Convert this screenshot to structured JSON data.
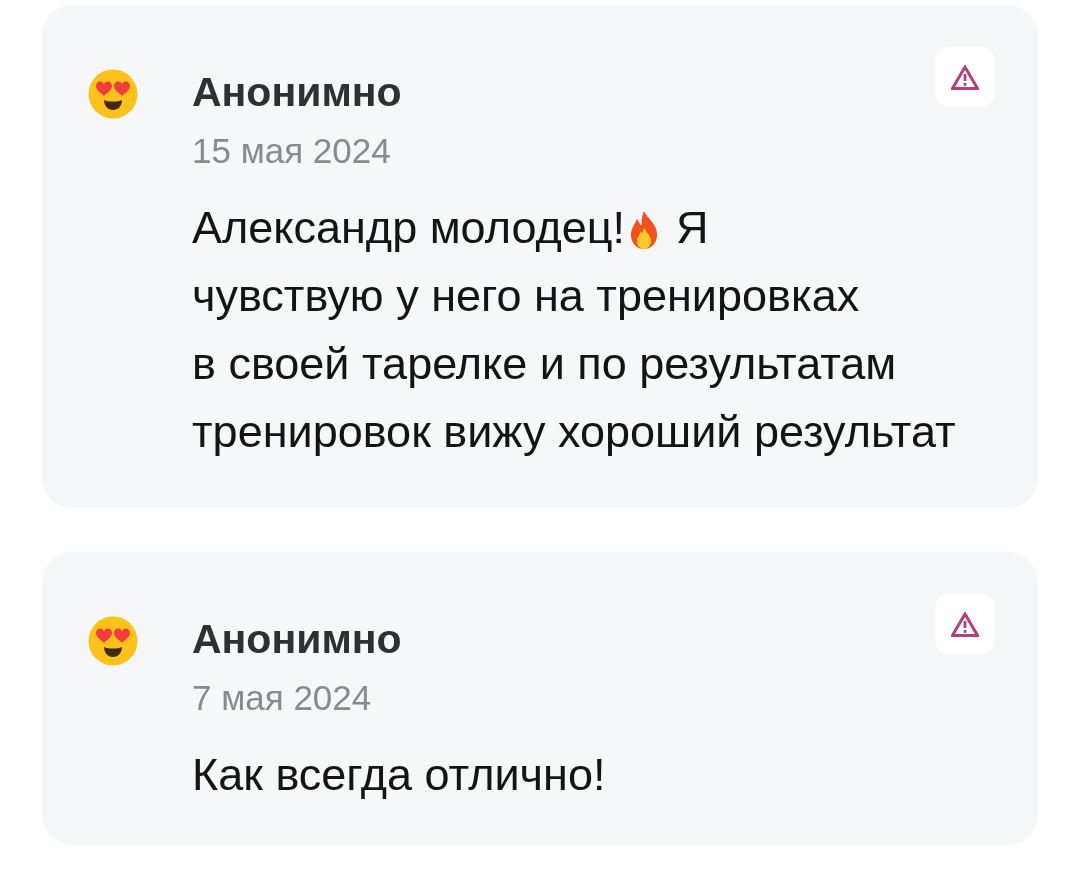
{
  "reviews": [
    {
      "author": "Анонимно",
      "date": "15 мая 2024",
      "comment": [
        {
          "parts": [
            {
              "kind": "text",
              "text": "Александр молодец!"
            },
            {
              "kind": "icon"
            },
            {
              "kind": "text",
              "text": "Я"
            }
          ]
        },
        {
          "parts": [
            {
              "kind": "text",
              "text": "чувствую у него на тренировках"
            }
          ]
        },
        {
          "parts": [
            {
              "kind": "text",
              "text": "в своей тарелке и по результатам"
            }
          ]
        },
        {
          "parts": [
            {
              "kind": "text",
              "text": "тренировок вижу хороший результат"
            }
          ]
        }
      ]
    },
    {
      "author": "Анонимно",
      "date": "7 мая 2024",
      "comment": [
        {
          "parts": [
            {
              "kind": "text",
              "text": "Как всегда отлично!"
            }
          ]
        }
      ]
    }
  ]
}
